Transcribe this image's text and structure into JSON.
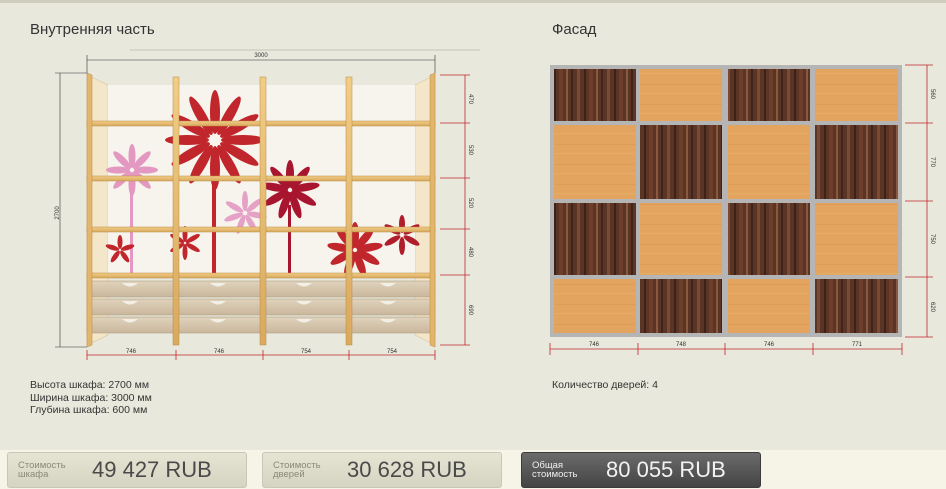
{
  "left_panel": {
    "title": "Внутренняя часть",
    "width_total": "3000",
    "height_total": "2700",
    "right_dims": [
      "470",
      "530",
      "520",
      "480",
      "690"
    ],
    "bottom_dims": [
      "746",
      "746",
      "754",
      "754"
    ],
    "info": {
      "height": "Высота шкафа: 2700 мм",
      "width": "Ширина шкафа: 3000 мм",
      "depth": "Глубина шкафа: 600 мм"
    }
  },
  "right_panel": {
    "title": "Фасад",
    "right_dims": [
      "560",
      "770",
      "750",
      "620"
    ],
    "bottom_dims": [
      "746",
      "748",
      "746",
      "771"
    ],
    "doors_count": "Количество дверей: 4"
  },
  "costs": {
    "cabinet": {
      "label": "Стоимость шкафа",
      "value": "49 427  RUB"
    },
    "doors": {
      "label": "Стоимость дверей",
      "value": "30 628  RUB"
    },
    "total": {
      "label": "Общая стоимость",
      "value": "80 055  RUB"
    }
  },
  "colors": {
    "accent_red": "#c0262b",
    "wood_light": "#e2a45e",
    "wood_dark": "#5a3424",
    "frame": "#a9a9a9"
  }
}
